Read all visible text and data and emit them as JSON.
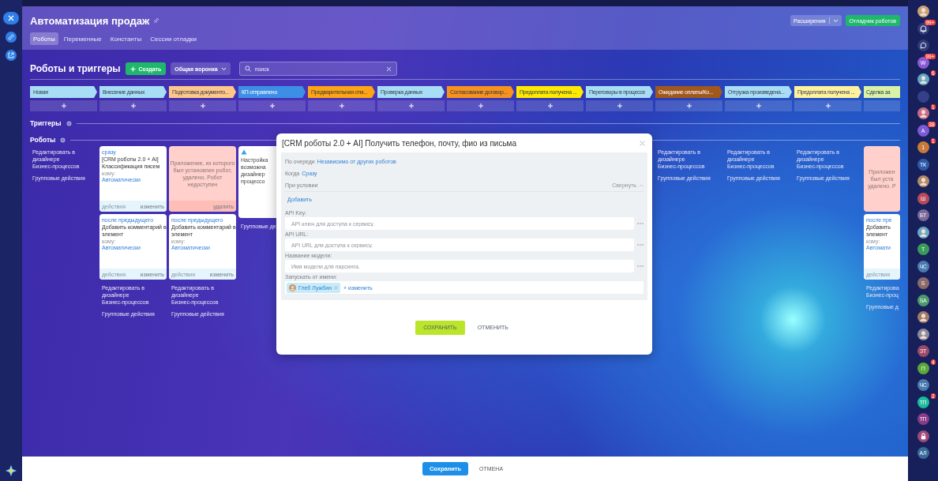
{
  "header": {
    "title": "Автоматизация продаж",
    "tabs": [
      {
        "label": "Роботы",
        "selected": true
      },
      {
        "label": "Переменные",
        "selected": false
      },
      {
        "label": "Константы",
        "selected": false
      },
      {
        "label": "Сессии отладки",
        "selected": false
      }
    ],
    "extensions": "Расширения",
    "debugger": "Отладчик роботов"
  },
  "toolbar": {
    "title": "Роботы и триггеры",
    "create": "Создать",
    "funnel": "Общая воронка",
    "search_placeholder": "поиск"
  },
  "stages": [
    {
      "name": "Новая",
      "color": "#a8def5"
    },
    {
      "name": "Внесение данных",
      "color": "#a8def5"
    },
    {
      "name": "Подготовка документо...",
      "color": "#ffc88a"
    },
    {
      "name": "КП отправлено",
      "color": "#3d8fe6"
    },
    {
      "name": "Предварительная отм...",
      "color": "#ffa412"
    },
    {
      "name": "Проверка данных",
      "color": "#a8def5"
    },
    {
      "name": "Согласование договор...",
      "color": "#f7921e"
    },
    {
      "name": "Предоплата получена ...",
      "color": "#ffeb00"
    },
    {
      "name": "Переговоры в процессе",
      "color": "#a8def5"
    },
    {
      "name": "Ожидание оплаты/Ко...",
      "color": "#a0581c"
    },
    {
      "name": "Отгрузка произведена...",
      "color": "#a8def5"
    },
    {
      "name": "Предоплата получена ...",
      "color": "#fff29e"
    },
    {
      "name": "Сделка за",
      "color": "#d9f2a6"
    }
  ],
  "sections": {
    "triggers": "Триггеры",
    "robots": "Роботы"
  },
  "robot_columns": [
    {
      "links": [
        {
          "lines": [
            "Редактировать в дизайнере",
            "Бизнес-процессов"
          ]
        },
        {
          "lines": [
            "Групповые действия"
          ]
        }
      ]
    },
    {
      "cards": [
        {
          "kind": "robot",
          "delay": "сразу",
          "title_lines": [
            "[CRM роботы 2.0 + AI]",
            "Классификация писем"
          ],
          "recipient_label": "кому:",
          "recipient": "Автоматически",
          "actions": "действия",
          "edit": "изменить"
        },
        {
          "kind": "robot",
          "delay": "после предыдущего",
          "title_lines": [
            "Добавить комментарий в",
            "элемент"
          ],
          "recipient_label": "кому:",
          "recipient": "Автоматически",
          "actions": "действия",
          "edit": "изменить"
        }
      ],
      "links": [
        {
          "lines": [
            "Редактировать в дизайнере",
            "Бизнес-процессов"
          ]
        },
        {
          "lines": [
            "Групповые действия"
          ]
        }
      ]
    },
    {
      "cards": [
        {
          "kind": "error",
          "lines": [
            "Приложение, из которого",
            "был установлен робот,",
            "удалено. Робот недоступен"
          ],
          "delete": "удалить"
        },
        {
          "kind": "robot",
          "delay": "после предыдущего",
          "title_lines": [
            "Добавить комментарий в",
            "элемент"
          ],
          "recipient_label": "кому:",
          "recipient": "Автоматически",
          "actions": "действия",
          "edit": "изменить"
        }
      ],
      "links": [
        {
          "lines": [
            "Редактировать в дизайнере",
            "Бизнес-процессов"
          ]
        },
        {
          "lines": [
            "Групповые действия"
          ]
        }
      ]
    },
    {
      "cards": [
        {
          "kind": "warning",
          "lines": [
            "Настройка",
            "возможна",
            "дизайнер",
            "процессо"
          ]
        }
      ],
      "links": [
        {
          "lines": [
            "Групповые де"
          ]
        }
      ]
    },
    {},
    {},
    {},
    {},
    {},
    {
      "links": [
        {
          "lines": [
            "Редактировать в дизайнере",
            "Бизнес-процессов"
          ]
        },
        {
          "lines": [
            "Групповые действия"
          ]
        }
      ]
    },
    {
      "links": [
        {
          "lines": [
            "Редактировать в дизайнере",
            "Бизнес-процессов"
          ]
        },
        {
          "lines": [
            "Групповые действия"
          ]
        }
      ]
    },
    {
      "links": [
        {
          "lines": [
            "Редактировать в дизайнере",
            "Бизнес-процессов"
          ]
        },
        {
          "lines": [
            "Групповые действия"
          ]
        }
      ]
    },
    {
      "cards": [
        {
          "kind": "error",
          "lines": [
            "Приложен",
            "был уста",
            "удалено. Р"
          ]
        },
        {
          "kind": "robot",
          "delay": "после пре",
          "title_lines": [
            "Добавить",
            "элемент"
          ],
          "recipient_label": "кому:",
          "recipient": "Автомати",
          "actions": "действия"
        }
      ],
      "links": [
        {
          "lines": [
            "Редактирова",
            "Бизнес-проц"
          ]
        },
        {
          "lines": [
            "Групповые д"
          ]
        }
      ]
    }
  ],
  "modal": {
    "title": "[CRM роботы 2.0 + AI] Получить телефон, почту, фио из письма",
    "order_label": "По очереди",
    "order_value": "Независимо от других роботов",
    "when_label": "Когда",
    "when_value": "Сразу",
    "condition_label": "При условии",
    "collapse": "Свернуть",
    "add": "Добавить",
    "fields": [
      {
        "label": "API Key:",
        "placeholder": "API ключ для доступа к сервису."
      },
      {
        "label": "API URL:",
        "placeholder": "API URL для доступа к сервису."
      },
      {
        "label": "Название модели:",
        "placeholder": "Имя модели для парсинга."
      }
    ],
    "run_as_label": "Запускать от имени:",
    "user": "Глеб Лужбин",
    "change": "+ изменить",
    "save": "СОХРАНИТЬ",
    "cancel": "ОТМЕНИТЬ"
  },
  "footer": {
    "save": "Сохранить",
    "cancel": "ОТМЕНА"
  },
  "right_bar": [
    {
      "kind": "photo",
      "color": "#c9a27a"
    },
    {
      "kind": "bell",
      "badge": "99+"
    },
    {
      "kind": "chat"
    },
    {
      "kind": "initials",
      "text": "W",
      "color": "#8a5ad6",
      "badge": "99+"
    },
    {
      "kind": "photo",
      "color": "#5fa6c8",
      "badge": "6"
    },
    {
      "kind": "blank",
      "color": "#34408a"
    },
    {
      "kind": "photo",
      "color": "#c86a8a",
      "badge": "1"
    },
    {
      "kind": "initials",
      "text": "A",
      "color": "#7a5ad6",
      "badge": "38"
    },
    {
      "kind": "initials",
      "text": "1",
      "color": "#c87a3a",
      "badge": "1"
    },
    {
      "kind": "initials",
      "text": "ТК",
      "color": "#2e5aa8"
    },
    {
      "kind": "photo",
      "color": "#b08a6a"
    },
    {
      "kind": "initials",
      "text": "Ш",
      "color": "#b84a5a"
    },
    {
      "kind": "initials",
      "text": "БТ",
      "color": "#7a6a9a"
    },
    {
      "kind": "photo",
      "color": "#6aa8c8"
    },
    {
      "kind": "initials",
      "text": "Т",
      "color": "#3a9a5a"
    },
    {
      "kind": "initials",
      "text": "ЧС",
      "color": "#4a7ab0"
    },
    {
      "kind": "initials",
      "text": "S",
      "color": "#8a6a6a"
    },
    {
      "kind": "initials",
      "text": "SA",
      "color": "#4a9a6a"
    },
    {
      "kind": "photo",
      "color": "#a07a6a"
    },
    {
      "kind": "photo",
      "color": "#8a8aa0"
    },
    {
      "kind": "initials",
      "text": "ЗТ",
      "color": "#9a4a6a"
    },
    {
      "kind": "initials",
      "text": "П",
      "color": "#5aa83a",
      "badge": "4"
    },
    {
      "kind": "initials",
      "text": "ЧС",
      "color": "#4a7ab0"
    },
    {
      "kind": "initials",
      "text": "ТП",
      "color": "#1abc9c",
      "badge": "2"
    },
    {
      "kind": "initials",
      "text": "ТП",
      "color": "#8a3a8a"
    },
    {
      "kind": "lock",
      "color": "#a04a7a"
    },
    {
      "kind": "initials",
      "text": "АЛ",
      "color": "#3a6a9a"
    }
  ]
}
